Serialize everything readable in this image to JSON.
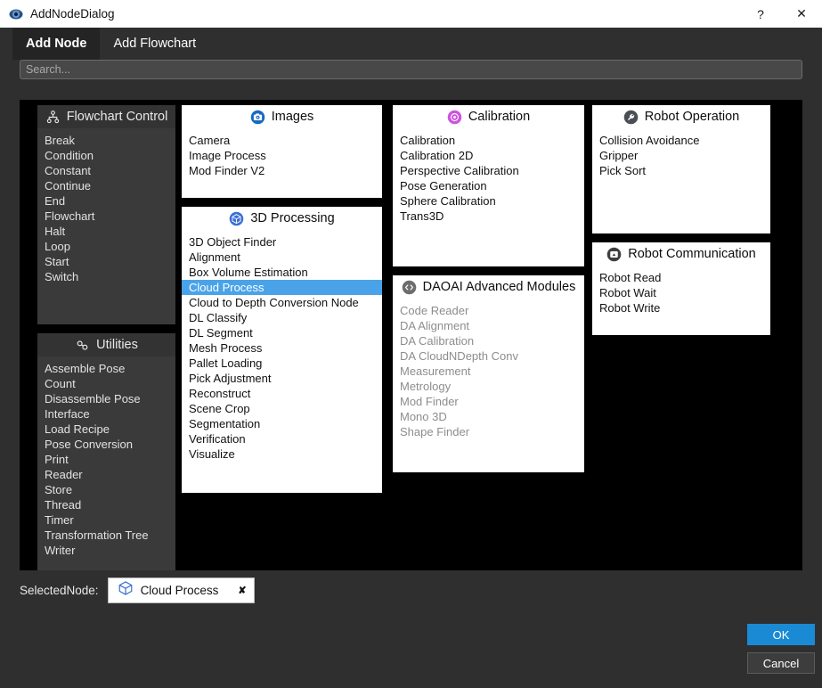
{
  "window": {
    "title": "AddNodeDialog",
    "app_icon": "daoai-eye-icon",
    "help_button": "?",
    "close_button": "✕"
  },
  "tabs": [
    {
      "label": "Add Node",
      "active": true
    },
    {
      "label": "Add Flowchart",
      "active": false
    }
  ],
  "search": {
    "value": "",
    "placeholder": "Search..."
  },
  "panels": [
    {
      "id": "flowchart-control",
      "title": "Flowchart Control",
      "icon": "org-chart-icon",
      "theme": "dark",
      "column": 0,
      "items": [
        {
          "label": "Break",
          "state": "normal"
        },
        {
          "label": "Condition",
          "state": "normal"
        },
        {
          "label": "Constant",
          "state": "normal"
        },
        {
          "label": "Continue",
          "state": "normal"
        },
        {
          "label": "End",
          "state": "normal"
        },
        {
          "label": "Flowchart",
          "state": "normal"
        },
        {
          "label": "Halt",
          "state": "normal"
        },
        {
          "label": "Loop",
          "state": "normal"
        },
        {
          "label": "Start",
          "state": "normal"
        },
        {
          "label": "Switch",
          "state": "normal"
        }
      ]
    },
    {
      "id": "utilities",
      "title": "Utilities",
      "icon": "link-chain-icon",
      "theme": "dark",
      "column": 0,
      "items": [
        {
          "label": "Assemble Pose",
          "state": "normal"
        },
        {
          "label": "Count",
          "state": "normal"
        },
        {
          "label": "Disassemble Pose",
          "state": "normal"
        },
        {
          "label": "Interface",
          "state": "normal"
        },
        {
          "label": "Load Recipe",
          "state": "normal"
        },
        {
          "label": "Pose Conversion",
          "state": "normal"
        },
        {
          "label": "Print",
          "state": "normal"
        },
        {
          "label": "Reader",
          "state": "normal"
        },
        {
          "label": "Store",
          "state": "normal"
        },
        {
          "label": "Thread",
          "state": "normal"
        },
        {
          "label": "Timer",
          "state": "normal"
        },
        {
          "label": "Transformation Tree",
          "state": "normal"
        },
        {
          "label": "Writer",
          "state": "normal"
        }
      ]
    },
    {
      "id": "images",
      "title": "Images",
      "icon": "camera-icon",
      "theme": "light",
      "column": 1,
      "items": [
        {
          "label": "Camera",
          "state": "normal"
        },
        {
          "label": "Image Process",
          "state": "normal"
        },
        {
          "label": "Mod Finder V2",
          "state": "normal"
        }
      ]
    },
    {
      "id": "3d-processing",
      "title": "3D Processing",
      "icon": "cube-icon",
      "theme": "light",
      "column": 1,
      "items": [
        {
          "label": "3D Object Finder",
          "state": "normal"
        },
        {
          "label": "Alignment",
          "state": "normal"
        },
        {
          "label": "Box Volume Estimation",
          "state": "normal"
        },
        {
          "label": "Cloud Process",
          "state": "selected"
        },
        {
          "label": "Cloud to Depth Conversion Node",
          "state": "normal"
        },
        {
          "label": "DL Classify",
          "state": "normal"
        },
        {
          "label": "DL Segment",
          "state": "normal"
        },
        {
          "label": "Mesh Process",
          "state": "normal"
        },
        {
          "label": "Pallet Loading",
          "state": "normal"
        },
        {
          "label": "Pick Adjustment",
          "state": "normal"
        },
        {
          "label": "Reconstruct",
          "state": "normal"
        },
        {
          "label": "Scene Crop",
          "state": "normal"
        },
        {
          "label": "Segmentation",
          "state": "normal"
        },
        {
          "label": "Verification",
          "state": "normal"
        },
        {
          "label": "Visualize",
          "state": "normal"
        }
      ]
    },
    {
      "id": "calibration",
      "title": "Calibration",
      "icon": "target-icon",
      "theme": "light",
      "column": 2,
      "items": [
        {
          "label": "Calibration",
          "state": "normal"
        },
        {
          "label": "Calibration 2D",
          "state": "normal"
        },
        {
          "label": "Perspective Calibration",
          "state": "normal"
        },
        {
          "label": "Pose Generation",
          "state": "normal"
        },
        {
          "label": "Sphere Calibration",
          "state": "normal"
        },
        {
          "label": "Trans3D",
          "state": "normal"
        }
      ]
    },
    {
      "id": "daoai-advanced-modules",
      "title": "DAOAI Advanced Modules",
      "icon": "code-brackets-icon",
      "theme": "light",
      "column": 2,
      "items": [
        {
          "label": "Code Reader",
          "state": "disabled"
        },
        {
          "label": "DA Alignment",
          "state": "disabled"
        },
        {
          "label": "DA Calibration",
          "state": "disabled"
        },
        {
          "label": "DA CloudNDepth Conv",
          "state": "disabled"
        },
        {
          "label": "Measurement",
          "state": "disabled"
        },
        {
          "label": "Metrology",
          "state": "disabled"
        },
        {
          "label": "Mod Finder",
          "state": "disabled"
        },
        {
          "label": "Mono 3D",
          "state": "disabled"
        },
        {
          "label": "Shape Finder",
          "state": "disabled"
        }
      ]
    },
    {
      "id": "robot-operation",
      "title": "Robot Operation",
      "icon": "wrench-icon",
      "theme": "light",
      "column": 3,
      "items": [
        {
          "label": "Collision Avoidance",
          "state": "normal"
        },
        {
          "label": "Gripper",
          "state": "normal"
        },
        {
          "label": "Pick Sort",
          "state": "normal"
        }
      ]
    },
    {
      "id": "robot-communication",
      "title": "Robot Communication",
      "icon": "message-icon",
      "theme": "light",
      "column": 3,
      "items": [
        {
          "label": "Robot Read",
          "state": "normal"
        },
        {
          "label": "Robot Wait",
          "state": "normal"
        },
        {
          "label": "Robot Write",
          "state": "normal"
        }
      ]
    }
  ],
  "selected_node": {
    "label": "SelectedNode:",
    "chip_text": "Cloud Process",
    "chip_icon": "cube-outline-icon",
    "chip_close": "✘"
  },
  "buttons": {
    "ok": "OK",
    "cancel": "Cancel"
  },
  "colors": {
    "accent_blue": "#1a8ad4",
    "selection_blue": "#4aa3e8",
    "window_bg": "#2f2f2f",
    "canvas_bg": "#000000",
    "panel_dark": "#3a3a3a",
    "panel_light": "#ffffff",
    "calibration_icon": "#cc55dd",
    "images_icon": "#1769c4",
    "cube_icon": "#3b6fd4"
  }
}
